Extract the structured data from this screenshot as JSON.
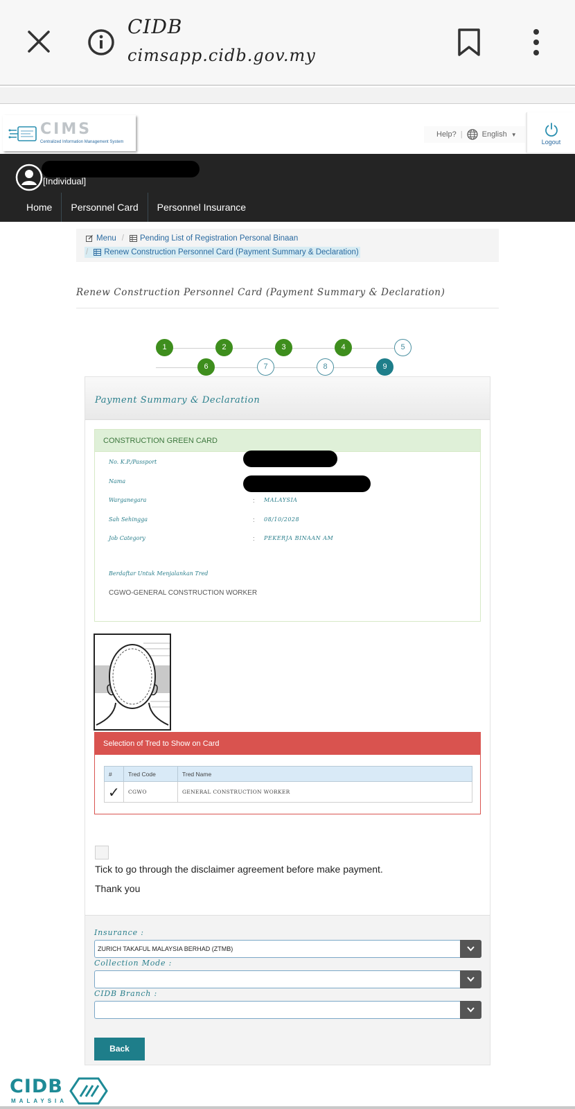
{
  "browser": {
    "title": "CIDB",
    "url": "cimsapp.cidb.gov.my",
    "close_icon": "close-icon",
    "info_icon": "info-icon",
    "bookmark_icon": "bookmark-icon",
    "menu_icon": "more-vert-icon"
  },
  "header": {
    "logo_text": "CIMS",
    "logo_subtitle": "Centralized Information Management System",
    "help_label": "Help?",
    "language": "English",
    "logout_label": "Logout"
  },
  "user": {
    "role": "[Individual]"
  },
  "nav": {
    "items": [
      "Home",
      "Personnel Card",
      "Personnel Insurance"
    ]
  },
  "breadcrumb": {
    "menu": "Menu",
    "pending": "Pending List of Registration Personal Binaan",
    "current": "Renew Construction Personnel Card (Payment Summary & Declaration)"
  },
  "page_title": "Renew Construction Personnel Card (Payment Summary & Declaration)",
  "steps": {
    "row1": [
      "1",
      "2",
      "3",
      "4",
      "5"
    ],
    "row2": [
      "6",
      "7",
      "8",
      "9"
    ]
  },
  "panel": {
    "title": "Payment Summary & Declaration",
    "green_card": {
      "heading": "CONSTRUCTION GREEN CARD",
      "fields": [
        {
          "label": "No. K.P./Passport",
          "value": ""
        },
        {
          "label": "Nama",
          "value": ""
        },
        {
          "label": "Warganegara",
          "value": "MALAYSIA"
        },
        {
          "label": "Sah Sehingga",
          "value": "08/10/2028"
        },
        {
          "label": "Job Category",
          "value": "PEKERJA BINAAN AM"
        }
      ],
      "colon": ":",
      "reg_label": "Berdaftar Untuk Menjalankan Tred",
      "reg_value": "CGWO-GENERAL CONSTRUCTION WORKER"
    },
    "tred": {
      "heading": "Selection of Tred to Show on Card",
      "columns": [
        "#",
        "Tred Code",
        "Tred Name"
      ],
      "row": {
        "check": "✓",
        "code": "CGWO",
        "name": "GENERAL CONSTRUCTION WORKER"
      }
    },
    "disclaimer": "Tick to go through the disclaimer agreement before make payment.",
    "thanks": "Thank you",
    "form": {
      "insurance_label": "Insurance :",
      "insurance_value": "ZURICH TAKAFUL MALAYSIA BERHAD (ZTMB)",
      "collection_label": "Collection Mode :",
      "collection_value": "",
      "branch_label": "CIDB Branch :",
      "branch_value": "",
      "back_label": "Back"
    }
  },
  "footer": {
    "logo_text": "CIDB",
    "logo_sub": "MALAYSIA"
  },
  "colors": {
    "done_step": "#3e8e1d",
    "current_step": "#1e7e8a",
    "teal_text": "#2a7f8c",
    "danger": "#d9534f",
    "success_bg": "#dff0d8"
  }
}
